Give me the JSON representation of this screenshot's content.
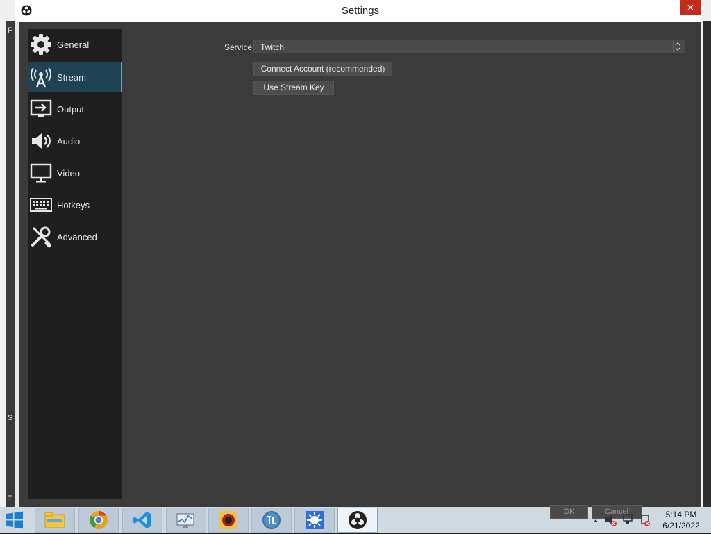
{
  "window": {
    "title": "Settings",
    "close_glyph": "✕"
  },
  "background": {
    "edge_chars": [
      "F",
      "S",
      "T"
    ]
  },
  "sidebar": {
    "items": [
      {
        "label": "General",
        "icon": "gear-icon",
        "active": false
      },
      {
        "label": "Stream",
        "icon": "broadcast-tower-icon",
        "active": true
      },
      {
        "label": "Output",
        "icon": "output-monitor-icon",
        "active": false
      },
      {
        "label": "Audio",
        "icon": "speaker-icon",
        "active": false
      },
      {
        "label": "Video",
        "icon": "monitor-icon",
        "active": false
      },
      {
        "label": "Hotkeys",
        "icon": "keyboard-icon",
        "active": false
      },
      {
        "label": "Advanced",
        "icon": "wrench-screwdriver-icon",
        "active": false
      }
    ]
  },
  "stream": {
    "service_label": "Service",
    "service_value": "Twitch",
    "connect_button": "Connect Account (recommended)",
    "stream_key_button": "Use Stream Key"
  },
  "dialog_buttons": {
    "ok": "OK",
    "cancel": "Cancel"
  },
  "taskbar": {
    "apps": [
      "file-explorer-icon",
      "chrome-canary-icon",
      "vscode-icon",
      "performance-monitor-icon",
      "game-app-icon",
      "tl-app-icon",
      "sun-app-icon",
      "obs-icon"
    ],
    "active_app": "obs-icon",
    "time": "5:14 PM",
    "date": "6/21/2022"
  },
  "colors": {
    "accent_active": "#1f4255",
    "accent_border": "#5aa8c8",
    "close_red": "#c42b1c",
    "panel_bg": "#3b3b3b",
    "sidebar_bg": "#1f1f1f"
  }
}
